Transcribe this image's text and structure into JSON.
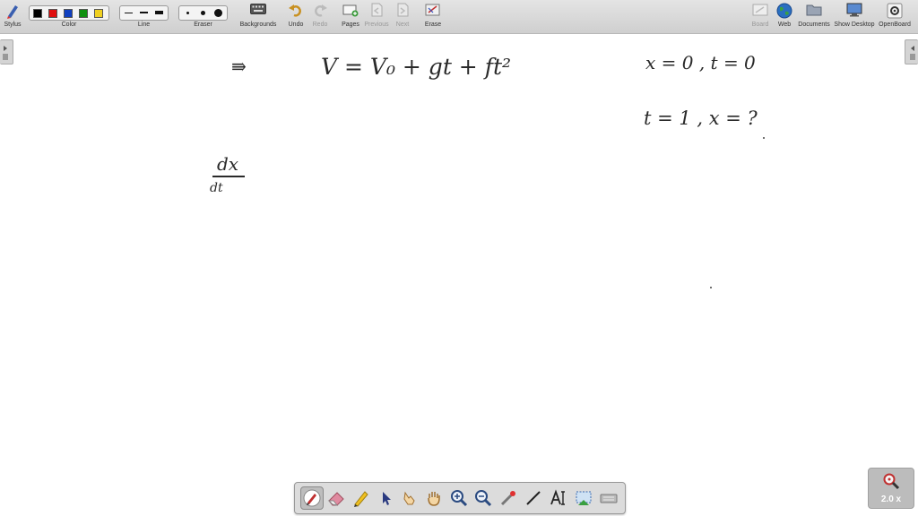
{
  "toolbar": {
    "left_items": [
      {
        "label": "Stylus",
        "icon": "stylus-icon"
      },
      {
        "label": "Color"
      },
      {
        "label": "Line"
      },
      {
        "label": "Eraser"
      },
      {
        "label": "Backgrounds",
        "icon": "keyboard-icon"
      },
      {
        "label": "Undo",
        "icon": "undo-icon"
      },
      {
        "label": "Redo",
        "icon": "redo-icon",
        "disabled": true
      },
      {
        "label": "Pages",
        "icon": "pages-icon"
      },
      {
        "label": "Previous",
        "icon": "previous-icon",
        "disabled": true
      },
      {
        "label": "Next",
        "icon": "next-icon",
        "disabled": true
      },
      {
        "label": "Erase",
        "icon": "erase-icon"
      }
    ],
    "right_items": [
      {
        "label": "Board",
        "icon": "board-icon",
        "disabled": true
      },
      {
        "label": "Web",
        "icon": "globe-icon"
      },
      {
        "label": "Documents",
        "icon": "folder-icon"
      },
      {
        "label": "Show Desktop",
        "icon": "monitor-icon"
      },
      {
        "label": "OpenBoard",
        "icon": "gear-icon"
      }
    ],
    "colors": [
      "#000000",
      "#e01010",
      "#1040c0",
      "#109010",
      "#f0d020"
    ]
  },
  "canvas": {
    "lines": [
      {
        "id": "implies",
        "text": "⇛"
      },
      {
        "id": "equation",
        "text": "V = V₀ + gt + ft²"
      },
      {
        "id": "condition1",
        "text": "x = 0 , t = 0"
      },
      {
        "id": "condition2",
        "text": "t = 1 ,  x = ?"
      },
      {
        "id": "numerator",
        "text": "dx"
      },
      {
        "id": "denominator",
        "text": "dt"
      }
    ]
  },
  "zoom": {
    "label": "2.0 x"
  },
  "bottom_tools": [
    "pen-icon",
    "eraser-icon",
    "highlighter-icon",
    "pointer-icon",
    "select-hand-icon",
    "hand-icon",
    "zoom-in-icon",
    "zoom-out-icon",
    "laser-pointer-icon",
    "line-icon",
    "text-icon",
    "capture-icon",
    "keyboard-icon"
  ]
}
